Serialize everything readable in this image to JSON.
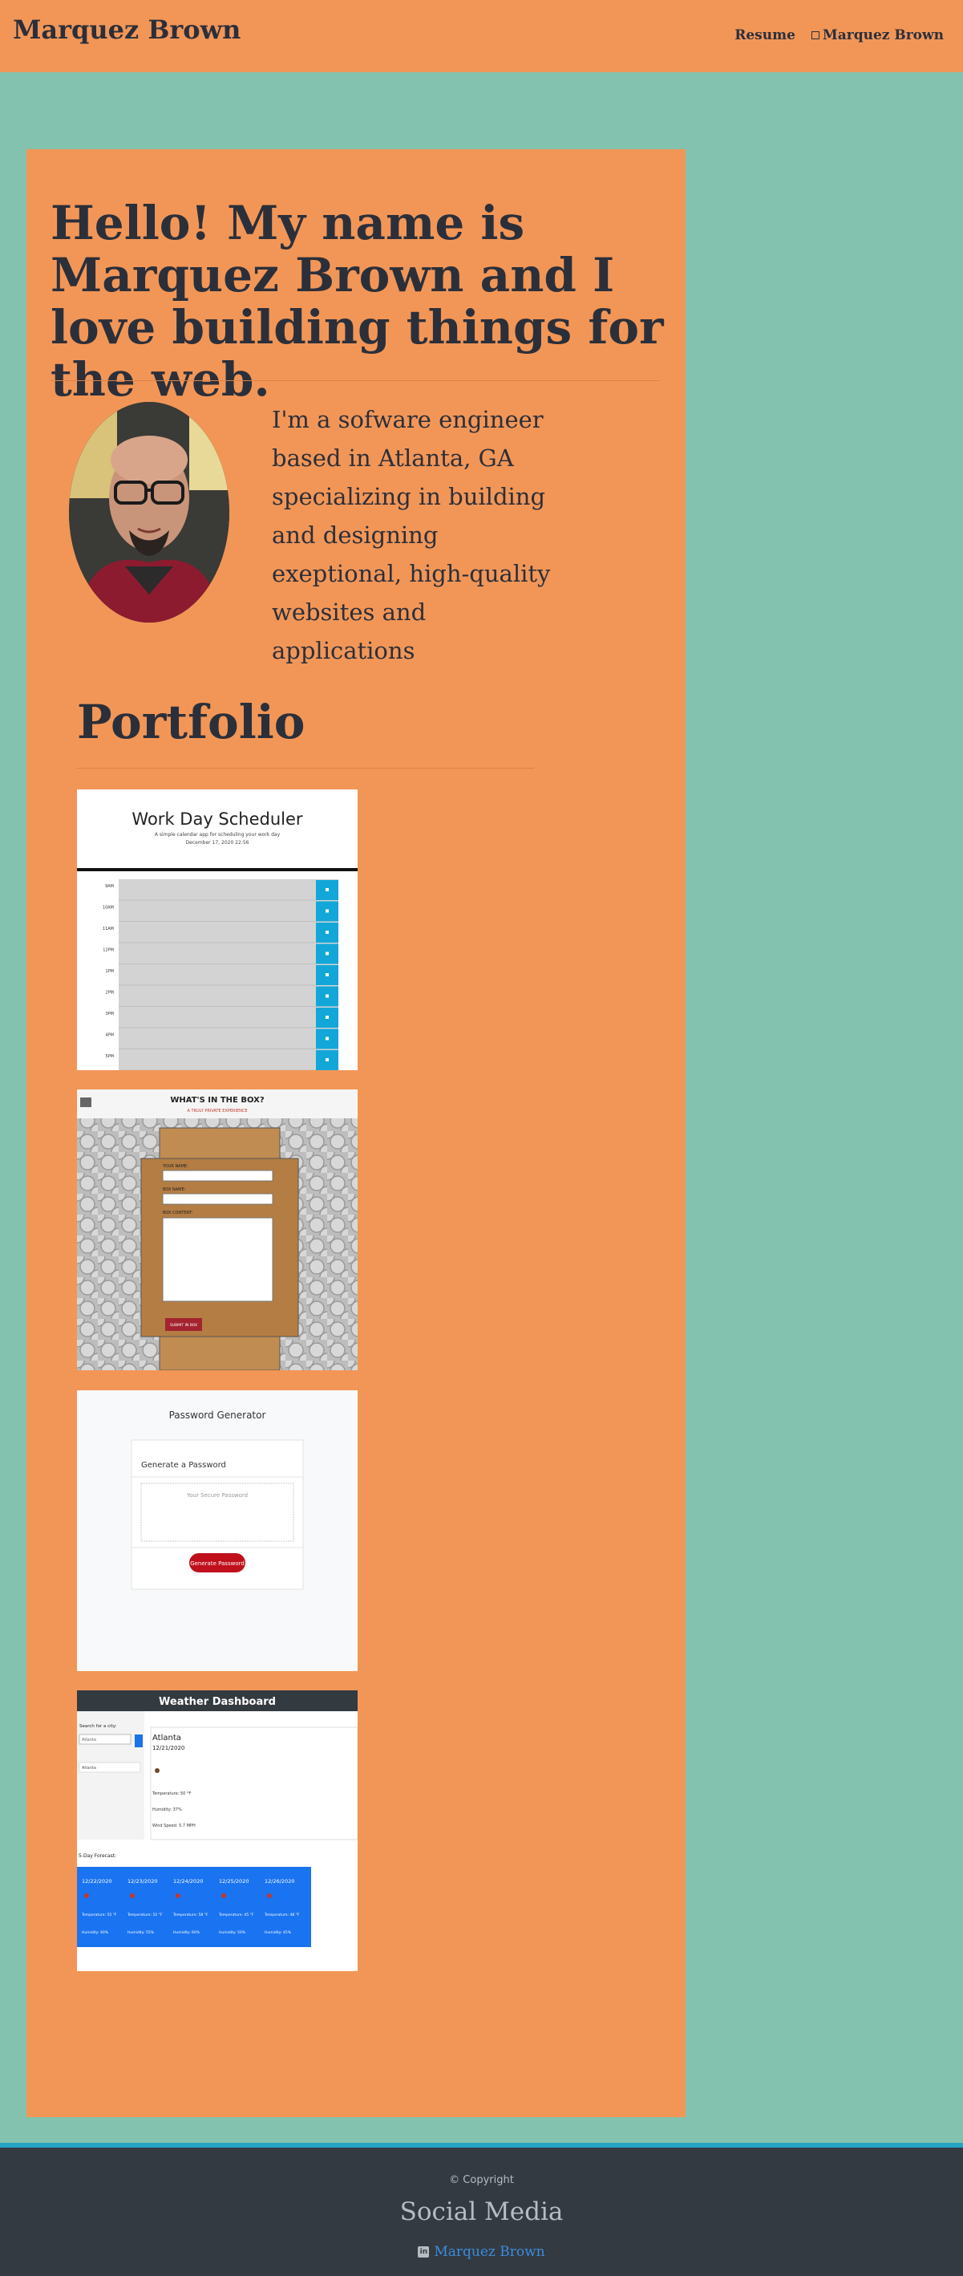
{
  "nav": {
    "brand": "Marquez Brown",
    "links": [
      {
        "label": "Resume"
      },
      {
        "label": "Marquez Brown",
        "icon": "broken-image-icon"
      }
    ]
  },
  "hero": {
    "heading": "Hello! My name is Marquez Brown and I love building things for the web.",
    "intro": "I'm a sofware engineer based in Atlanta, GA specializing in building and designing exeptional, high-quality websites and applications"
  },
  "portfolio": {
    "title": "Portfolio",
    "projects": [
      {
        "title": "Work Day Scheduler",
        "subtitle": "A simple calendar app for scheduling your work day",
        "date": "December 17, 2020 22:56",
        "hours": [
          "9AM",
          "10AM",
          "11AM",
          "12PM",
          "1PM",
          "2PM",
          "3PM",
          "4PM",
          "5PM"
        ]
      },
      {
        "title": "WHAT'S IN THE BOX?",
        "subtitle": "A TRULY PRIVATE EXPERIENCE",
        "fields": [
          "YOUR NAME:",
          "BOX NAME:",
          "BOX CONTENT:"
        ],
        "button": "SUBMIT IN BOX"
      },
      {
        "title": "Password Generator",
        "card_title": "Generate a Password",
        "placeholder": "Your Secure Password",
        "button": "Generate Password"
      },
      {
        "title": "Weather Dashboard",
        "search_label": "Search for a city:",
        "search_value": "Atlanta",
        "history_item": "Atlanta",
        "city": "Atlanta",
        "date": "12/21/2020",
        "temperature": "Temperature: 50 °F",
        "humidity": "Humidity: 37%",
        "wind": "Wind Speed: 5.7 MPH",
        "forecast_title": "5-Day Forecast:",
        "forecast": [
          {
            "date": "12/22/2020",
            "temp": "Temperature: 55 °F",
            "humidity": "Humidity: 40%"
          },
          {
            "date": "12/23/2020",
            "temp": "Temperature: 52 °F",
            "humidity": "Humidity: 55%"
          },
          {
            "date": "12/24/2020",
            "temp": "Temperature: 58 °F",
            "humidity": "Humidity: 60%"
          },
          {
            "date": "12/25/2020",
            "temp": "Temperature: 45 °F",
            "humidity": "Humidity: 50%"
          },
          {
            "date": "12/26/2020",
            "temp": "Temperature: 48 °F",
            "humidity": "Humidity: 45%"
          }
        ]
      }
    ]
  },
  "footer": {
    "copyright": "© Copyright",
    "social_title": "Social Media",
    "linkedin_label": "Marquez Brown"
  },
  "colors": {
    "page_bg": "#82c2ae",
    "accent": "#f29657",
    "text_dark": "#2b2f3a",
    "footer_bg": "#343a42",
    "footer_border": "#25a3c2",
    "link": "#3a8dde"
  }
}
